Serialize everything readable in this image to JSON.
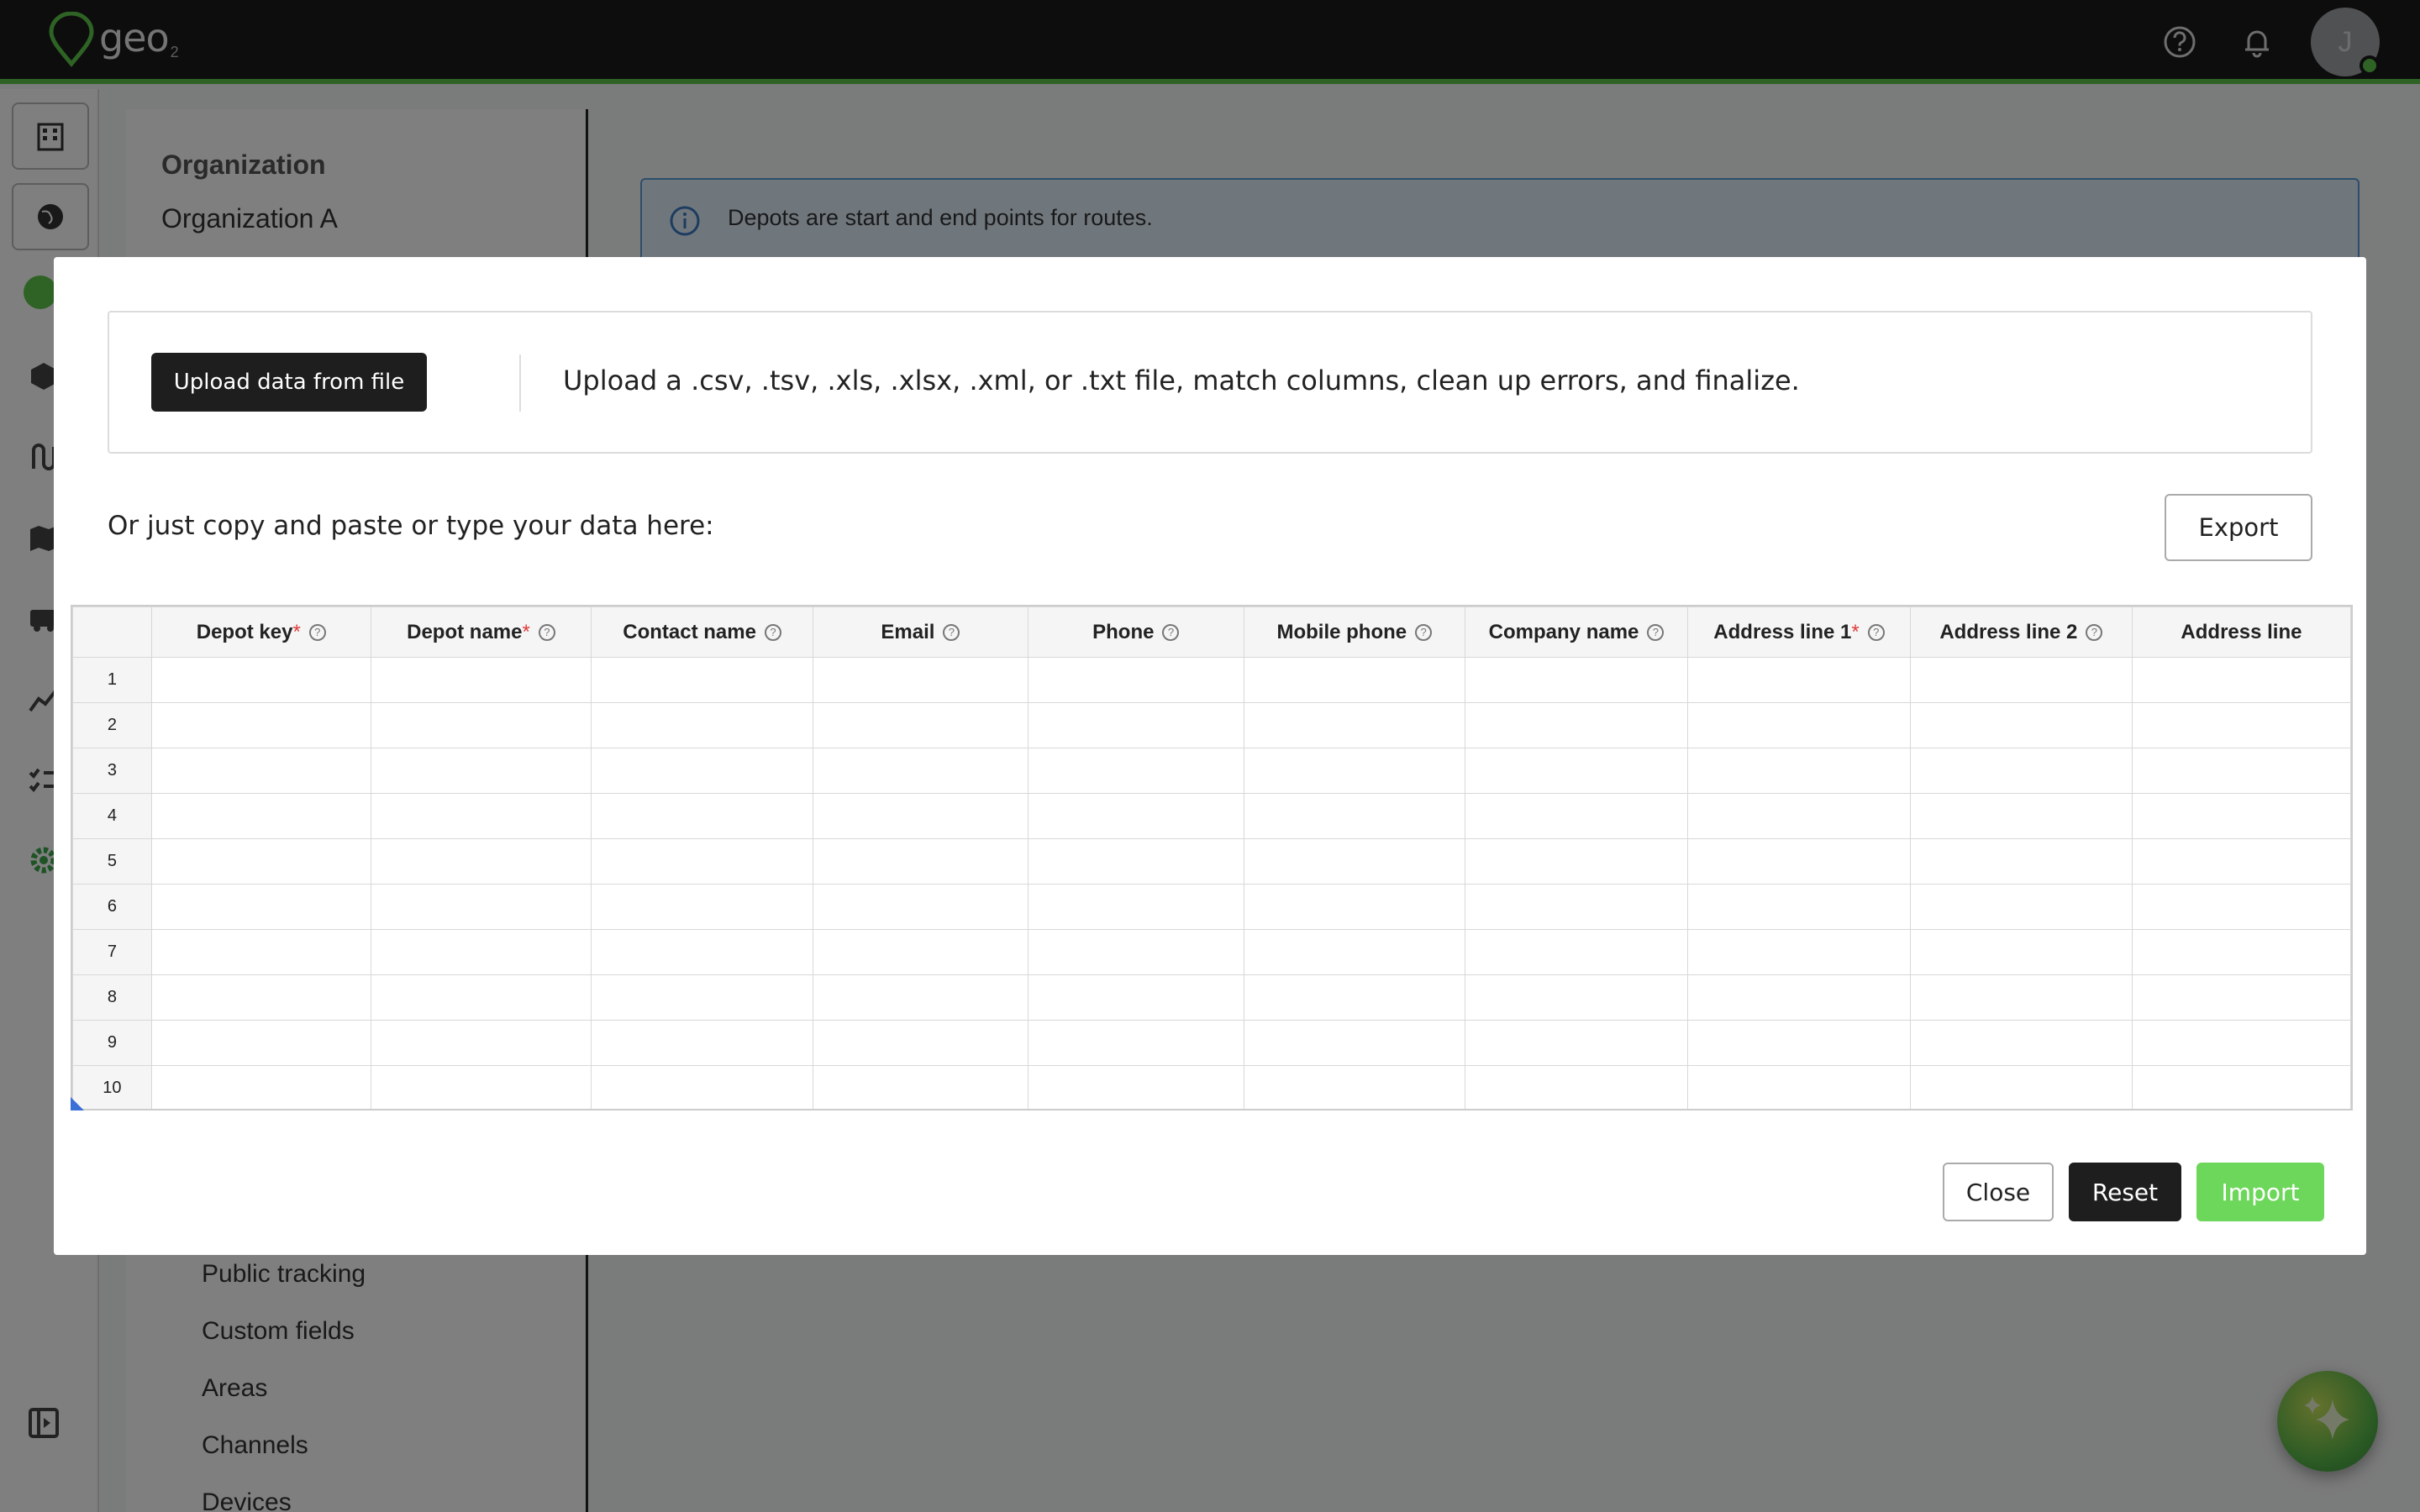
{
  "app": {
    "logo_text": "geo",
    "logo_sub": "2",
    "avatar_initial": "J"
  },
  "colors": {
    "accent_green": "#5cc74a",
    "import_green": "#6cd75a",
    "info_blue": "#5b9bd5",
    "required_red": "#e03b3b",
    "dark": "#1e1e1e"
  },
  "topbar": {
    "icons": [
      "help-icon",
      "bell-icon"
    ]
  },
  "rail": {
    "icons": [
      "building-icon",
      "globe-icon",
      "cube-icon",
      "route-icon",
      "map-icon",
      "truck-icon",
      "analytics-icon",
      "checklist-icon",
      "gear-icon",
      "collapse-sidebar-icon"
    ]
  },
  "settings": {
    "heading": "Organization",
    "org_name": "Organization A",
    "nav": [
      "Public tracking",
      "Custom fields",
      "Areas",
      "Channels",
      "Devices"
    ]
  },
  "banner": {
    "text": "Depots are start and end points for routes."
  },
  "modal": {
    "upload_button": "Upload data from file",
    "upload_description": "Upload a .csv, .tsv, .xls, .xlsx, .xml, or .txt file, match columns, clean up errors, and finalize.",
    "paste_prompt": "Or just copy and paste or type your data here:",
    "export_button": "Export",
    "close_button": "Close",
    "reset_button": "Reset",
    "import_button": "Import"
  },
  "grid": {
    "columns": [
      {
        "label": "Depot key",
        "required": true,
        "help": true
      },
      {
        "label": "Depot name",
        "required": true,
        "help": true
      },
      {
        "label": "Contact name",
        "required": false,
        "help": true
      },
      {
        "label": "Email",
        "required": false,
        "help": true
      },
      {
        "label": "Phone",
        "required": false,
        "help": true
      },
      {
        "label": "Mobile phone",
        "required": false,
        "help": true
      },
      {
        "label": "Company name",
        "required": false,
        "help": true
      },
      {
        "label": "Address line 1",
        "required": true,
        "help": true
      },
      {
        "label": "Address line 2",
        "required": false,
        "help": true
      },
      {
        "label": "Address line",
        "required": false,
        "help": false
      }
    ],
    "rows": [
      "1",
      "2",
      "3",
      "4",
      "5",
      "6",
      "7",
      "8",
      "9",
      "10"
    ]
  }
}
